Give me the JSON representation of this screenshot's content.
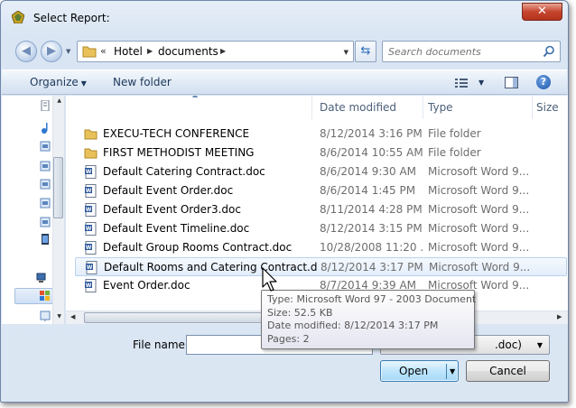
{
  "window": {
    "title": "Select Report:",
    "close_label": "✕"
  },
  "address_bar": {
    "chevrons": "«",
    "breadcrumbs": [
      "Hotel",
      "documents"
    ]
  },
  "search": {
    "placeholder": "Search documents"
  },
  "toolbar": {
    "organize_label": "Organize",
    "new_folder_label": "New folder",
    "help_label": "?"
  },
  "columns": {
    "name": "",
    "date_modified": "Date modified",
    "type": "Type",
    "size": "Size"
  },
  "files": [
    {
      "name": "EXECU-TECH CONFERENCE",
      "date": "8/12/2014 3:16 PM",
      "type": "File folder",
      "icon": "folder-icon"
    },
    {
      "name": "FIRST METHODIST MEETING",
      "date": "8/6/2014 10:55 AM",
      "type": "File folder",
      "icon": "folder-icon"
    },
    {
      "name": "Default Catering Contract.doc",
      "date": "8/6/2014 9:30 AM",
      "type": "Microsoft Word 9...",
      "icon": "word-doc-icon"
    },
    {
      "name": "Default Event Order.doc",
      "date": "8/6/2014 1:45 PM",
      "type": "Microsoft Word 9...",
      "icon": "word-doc-icon"
    },
    {
      "name": "Default Event Order3.doc",
      "date": "8/11/2014 4:28 PM",
      "type": "Microsoft Word 9...",
      "icon": "word-doc-icon"
    },
    {
      "name": "Default Event Timeline.doc",
      "date": "8/12/2014 3:15 PM",
      "type": "Microsoft Word 9...",
      "icon": "word-doc-icon"
    },
    {
      "name": "Default Group Rooms Contract.doc",
      "date": "10/28/2008 11:20 ...",
      "type": "Microsoft Word 9...",
      "icon": "word-doc-icon"
    },
    {
      "name": "Default Rooms and Catering Contract.doc",
      "date": "8/12/2014 3:17 PM",
      "type": "Microsoft Word 9...",
      "icon": "word-doc-icon"
    },
    {
      "name": "Event Order.doc",
      "date": "8/7/2014 9:39 AM",
      "type": "Microsoft Word 9...",
      "icon": "word-doc-icon"
    }
  ],
  "hovered_row": 7,
  "tooltip": {
    "type_line": "Type: Microsoft Word 97 - 2003 Document",
    "size_line": "Size: 52.5 KB",
    "date_line": "Date modified: 8/12/2014 3:17 PM",
    "pages_line": "Pages: 2"
  },
  "bottom": {
    "file_name_label": "File name:",
    "file_name_value": "",
    "filter_visible_text": ".doc)",
    "open_label": "Open",
    "cancel_label": "Cancel"
  },
  "colors": {
    "accent": "#3c7fb1",
    "folder": "#e8c15a",
    "word_blue": "#2b579a",
    "close_red": "#c6452e"
  }
}
